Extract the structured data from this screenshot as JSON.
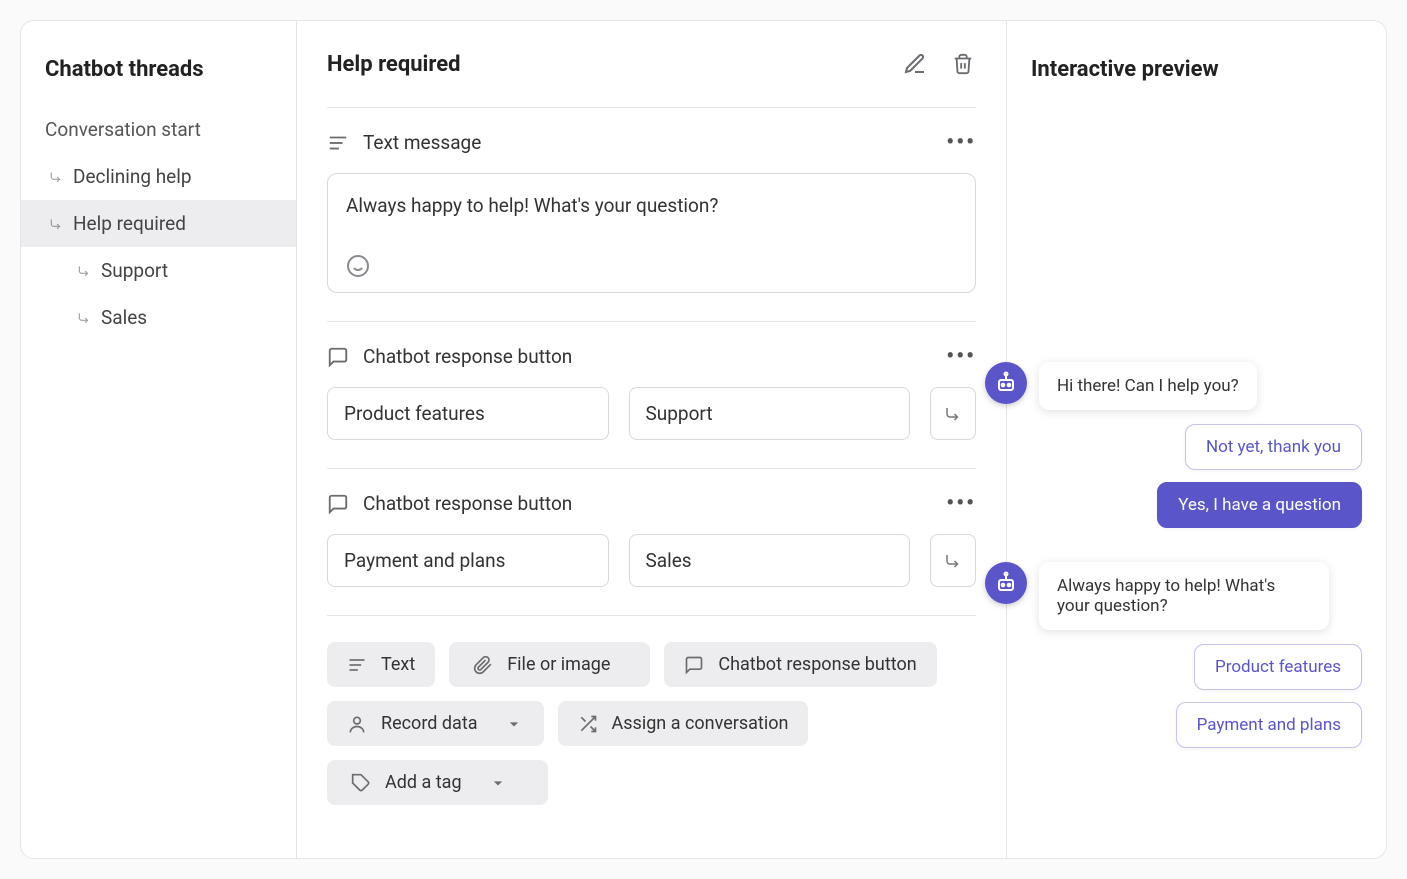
{
  "sidebar": {
    "title": "Chatbot threads",
    "root_item": "Conversation start",
    "items": [
      {
        "label": "Declining help",
        "level": 1
      },
      {
        "label": "Help required",
        "level": 1,
        "active": true
      },
      {
        "label": "Support",
        "level": 2
      },
      {
        "label": "Sales",
        "level": 2
      }
    ]
  },
  "main": {
    "title": "Help required",
    "blocks": {
      "text_message": {
        "label": "Text message",
        "content": "Always happy to help! What's your question?"
      },
      "response1": {
        "label": "Chatbot response button",
        "option_label": "Product features",
        "target_label": "Support"
      },
      "response2": {
        "label": "Chatbot response button",
        "option_label": "Payment and plans",
        "target_label": "Sales"
      }
    },
    "toolbar": {
      "text": "Text",
      "file": "File or image",
      "response": "Chatbot response button",
      "record": "Record data",
      "assign": "Assign a conversation",
      "tag": "Add a tag"
    }
  },
  "preview": {
    "title": "Interactive preview",
    "msg1": "Hi there! Can I help you?",
    "choice1": "Not yet, thank you",
    "choice2": "Yes, I have a question",
    "msg2": "Always happy to help! What's your question?",
    "choice3": "Product features",
    "choice4": "Payment and plans"
  }
}
